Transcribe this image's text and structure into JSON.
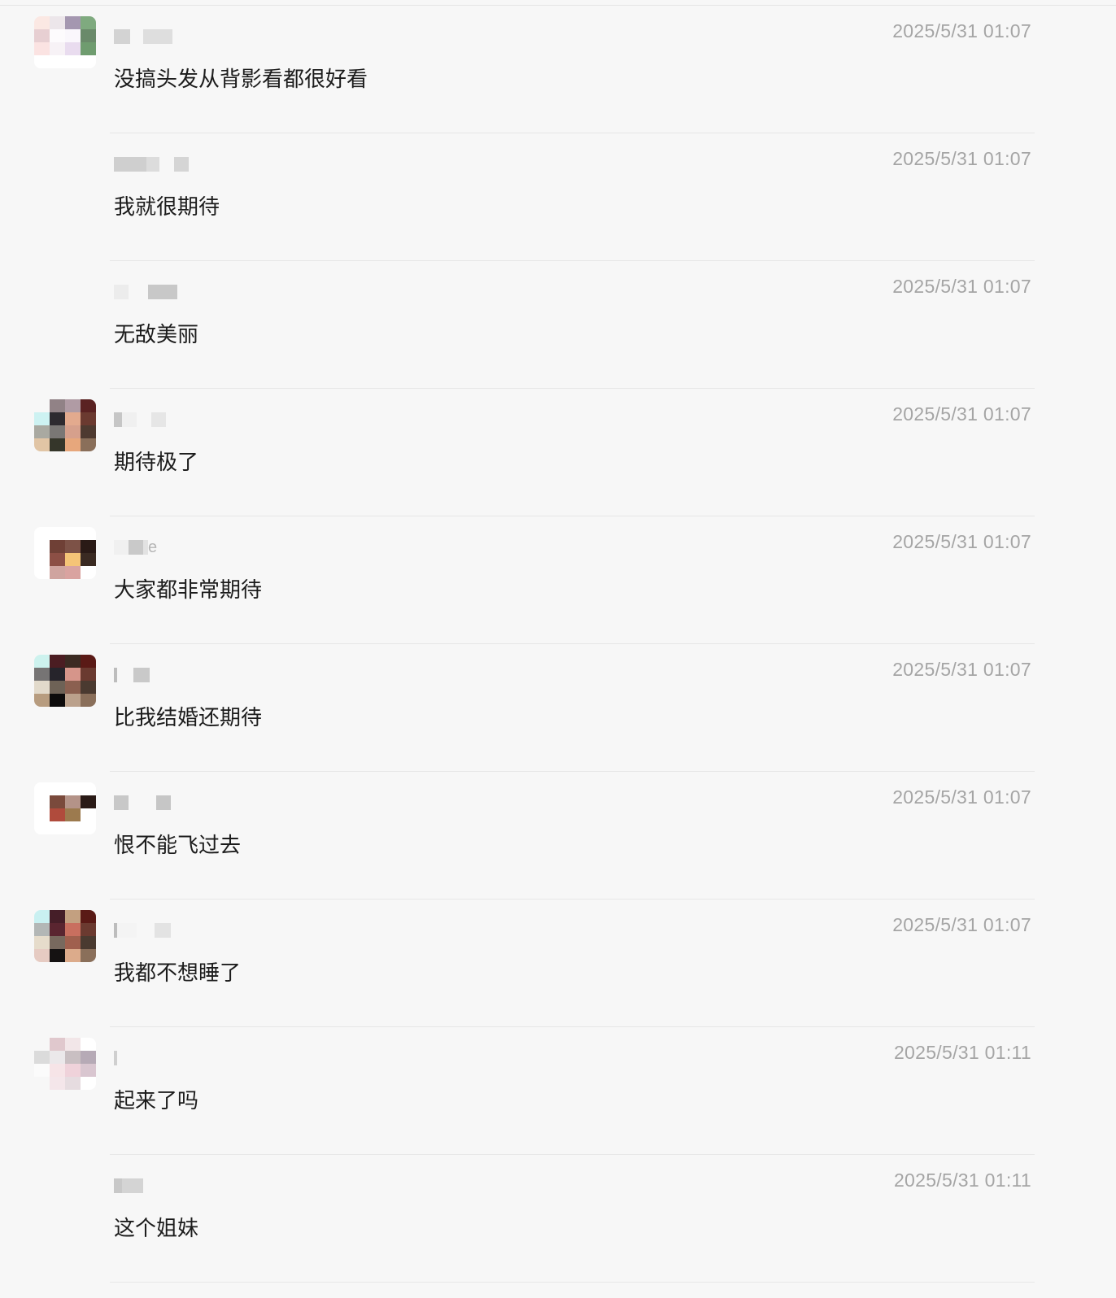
{
  "comments": [
    {
      "name": "",
      "time": "2025/5/31 01:07",
      "text": "没搞头发从背影看都很好看",
      "avatar": [
        "#fbe8e3",
        "#ece6ea",
        "#a497b0",
        "#7faa7f",
        "#e7cfd2",
        "#fdfbfd",
        "#faf7fc",
        "#6a8a6a",
        "#fbe3e2",
        "#f7f2f6",
        "#e9dcef",
        "#6f9c6f",
        "#ffffff",
        "#ffffff",
        "#ffffff",
        "#ffffff"
      ],
      "name_blocks": [
        [
          "#d3d3d3",
          20
        ],
        [
          "#f7f7f7",
          16
        ],
        [
          "#dedede",
          36
        ]
      ]
    },
    {
      "name": "",
      "time": "2025/5/31 01:07",
      "text": "我就很期待",
      "avatar": null,
      "name_blocks": [
        [
          "#cfcfcf",
          40
        ],
        [
          "#dcdcdc",
          16
        ],
        [
          "#f7f7f7",
          18
        ],
        [
          "#d5d5d5",
          18
        ]
      ]
    },
    {
      "name": "",
      "time": "2025/5/31 01:07",
      "text": "无敌美丽",
      "avatar": null,
      "name_blocks": [
        [
          "#ececec",
          18
        ],
        [
          "#f7f7f7",
          24
        ],
        [
          "#c8c8c8",
          36
        ]
      ]
    },
    {
      "name": "",
      "time": "2025/5/31 01:07",
      "text": "期待极了",
      "avatar": [
        "#f7f7f7",
        "#918286",
        "#b09ba4",
        "#5a2222",
        "#cdf2f2",
        "#2d2a2f",
        "#e3aa8e",
        "#6b3a30",
        "#a9a9a1",
        "#7a7775",
        "#d6a08c",
        "#4e3a30",
        "#e1c5a5",
        "#35362a",
        "#e7a77c",
        "#8a6f5a"
      ],
      "name_blocks": [
        [
          "#c6c6c6",
          10
        ],
        [
          "#f0f0f0",
          18
        ],
        [
          "#f7f7f7",
          18
        ],
        [
          "#e6e6e6",
          18
        ]
      ]
    },
    {
      "name": "e",
      "time": "2025/5/31 01:07",
      "text": "大家都非常期待",
      "avatar": [
        "#ffffff",
        "#ffffff",
        "#ffffff",
        "#ffffff",
        "#ffffff",
        "#6f4036",
        "#7d5247",
        "#2a1a16",
        "#ffffff",
        "#8c4f45",
        "#f5c477",
        "#3a2a22",
        "#ffffff",
        "#cfa49f",
        "#d9a3a0",
        "#ffffff"
      ],
      "name_blocks": [
        [
          "#f0f0f0",
          18
        ],
        [
          "#c9c9c9",
          18
        ],
        [
          "#e2e2e2",
          6
        ]
      ]
    },
    {
      "name": "",
      "time": "2025/5/31 01:07",
      "text": "比我结婚还期待",
      "avatar": [
        "#cdf2ee",
        "#4b1d22",
        "#3b2a22",
        "#5a1a16",
        "#767474",
        "#26242b",
        "#d6958a",
        "#6a3a30",
        "#e2dacb",
        "#6e6256",
        "#8b6050",
        "#4a3a30",
        "#b79c7f",
        "#0d0b0b",
        "#bba18c",
        "#8a6f5a"
      ],
      "name_blocks": [
        [
          "#bdbdbd",
          4
        ],
        [
          "#f7f7f7",
          20
        ],
        [
          "#c9c9c9",
          20
        ]
      ]
    },
    {
      "name": "",
      "time": "2025/5/31 01:07",
      "text": "恨不能飞过去",
      "avatar": [
        "#ffffff",
        "#ffffff",
        "#ffffff",
        "#ffffff",
        "#ffffff",
        "#7a4a3c",
        "#b49388",
        "#2a1a16",
        "#ffffff",
        "#b04b3c",
        "#9c7a4e",
        "#ffffff",
        "#ffffff",
        "#ffffff",
        "#ffffff",
        "#ffffff"
      ],
      "name_blocks": [
        [
          "#c8c8c8",
          18
        ],
        [
          "#f7f7f7",
          34
        ],
        [
          "#c6c6c6",
          18
        ]
      ]
    },
    {
      "name": "",
      "time": "2025/5/31 01:07",
      "text": "我都不想睡了",
      "avatar": [
        "#c9f0f1",
        "#451e28",
        "#c3a080",
        "#5a1a16",
        "#b3b7b6",
        "#5a2530",
        "#c96f5f",
        "#6b3a30",
        "#e6dccb",
        "#78695e",
        "#a0604e",
        "#4a3a30",
        "#e6cbc2",
        "#151212",
        "#dcab8b",
        "#8a6f5a"
      ],
      "name_blocks": [
        [
          "#bdbdbd",
          4
        ],
        [
          "#f4f4f4",
          24
        ],
        [
          "#f7f7f7",
          22
        ],
        [
          "#e3e3e3",
          20
        ]
      ]
    },
    {
      "name": "",
      "time": "2025/5/31 01:11",
      "text": "起来了吗",
      "avatar": [
        "#f7f7f7",
        "#e0c8cd",
        "#f2e6e8",
        "#ffffff",
        "#dbdbdb",
        "#ebe8ea",
        "#c9bfc2",
        "#b6aab6",
        "#fbfbfb",
        "#f6e4e7",
        "#efd2da",
        "#d9c6d0",
        "#f7f7f7",
        "#f4e6ea",
        "#e6dce0",
        "#ffffff"
      ],
      "name_blocks": [
        [
          "#cfcfcf",
          4
        ]
      ]
    },
    {
      "name": "",
      "time": "2025/5/31 01:11",
      "text": "这个姐妹",
      "avatar": null,
      "name_blocks": [
        [
          "#c8c8c8",
          10
        ],
        [
          "#d4d4d4",
          26
        ]
      ]
    }
  ]
}
